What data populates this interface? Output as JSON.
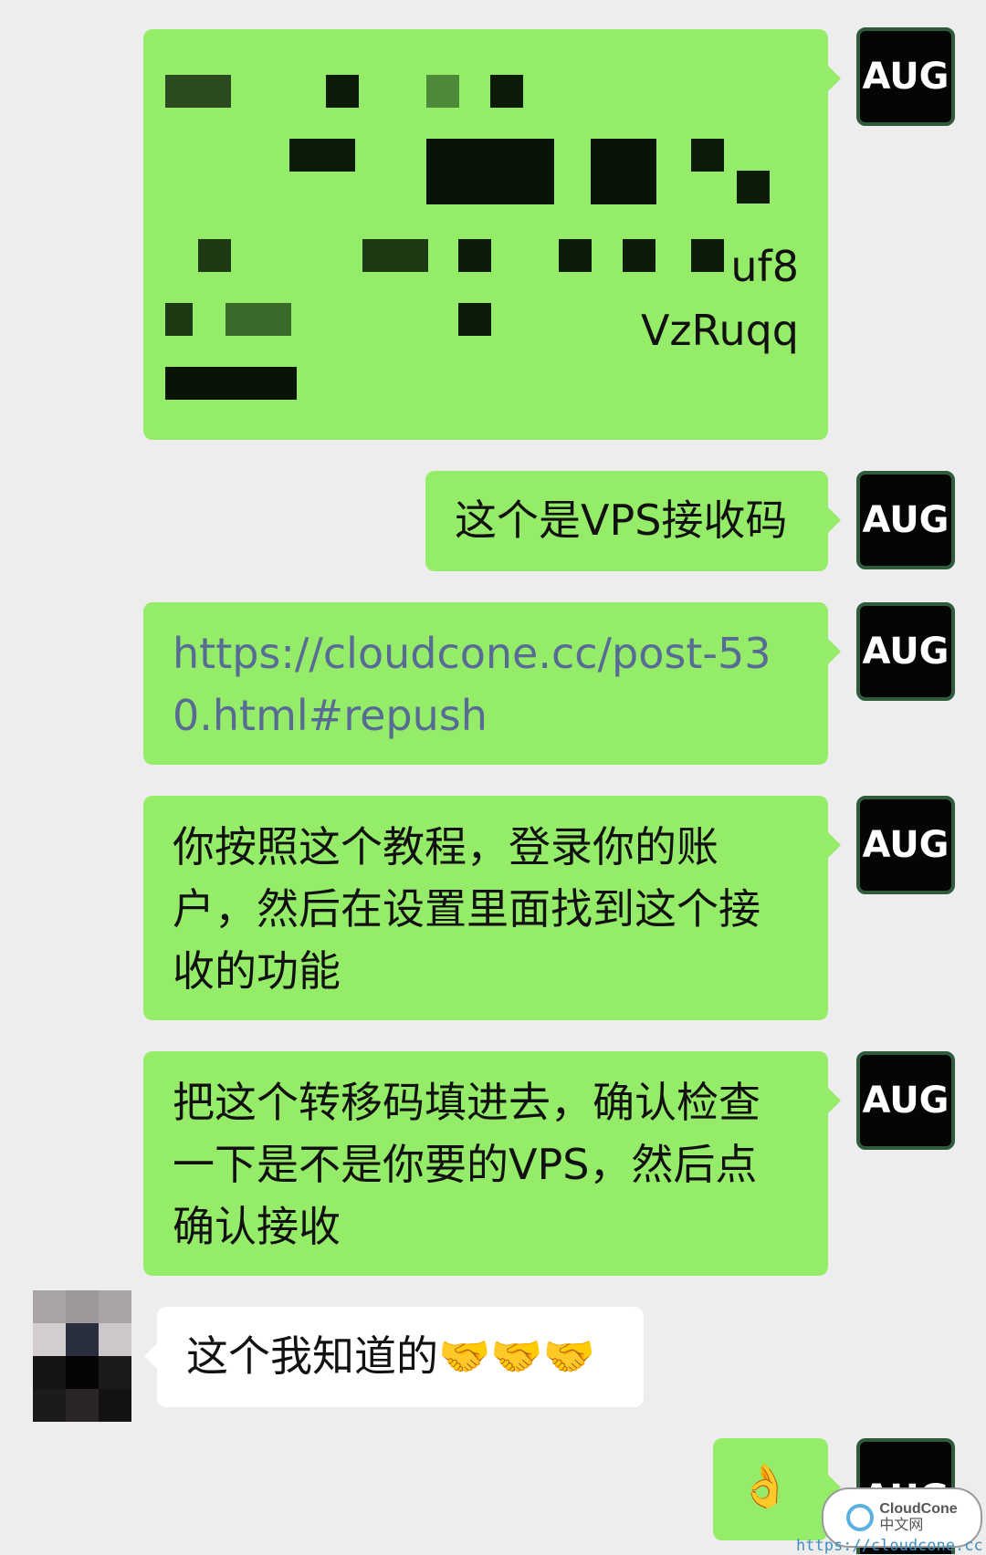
{
  "chat": {
    "my_avatar_label": "AUG",
    "messages": [
      {
        "sender": "me",
        "type": "code",
        "visible_fragments": [
          "uf8",
          "VzRuqq"
        ]
      },
      {
        "sender": "me",
        "type": "text",
        "text": "这个是VPS接收码"
      },
      {
        "sender": "me",
        "type": "link",
        "text": "https://cloudcone.cc/post-530.html#repush"
      },
      {
        "sender": "me",
        "type": "text",
        "text": "你按照这个教程，登录你的账户，然后在设置里面找到这个接收的功能"
      },
      {
        "sender": "me",
        "type": "text",
        "text": "把这个转移码填进去，确认检查一下是不是你要的VPS，然后点确认接收"
      },
      {
        "sender": "other",
        "type": "text",
        "text": "这个我知道的🤝🤝🤝"
      },
      {
        "sender": "me",
        "type": "emoji",
        "text": "👌"
      }
    ]
  },
  "watermark": {
    "brand": "CloudCone",
    "subtitle": "中文网",
    "url": "https://cloudcone.cc"
  },
  "colors": {
    "my_bubble": "#95ec69",
    "their_bubble": "#ffffff",
    "background": "#ededed",
    "link": "#576b95"
  }
}
